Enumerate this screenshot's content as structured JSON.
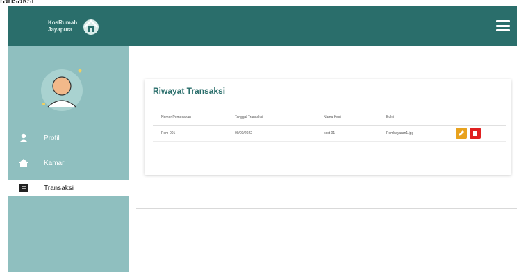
{
  "page": {
    "caption": "ransaksi"
  },
  "header": {
    "brand_line1": "KosRumah",
    "brand_line2": "Jayapura",
    "menu_icon": "hamburger-menu-icon"
  },
  "sidebar": {
    "items": [
      {
        "label": "Profil",
        "icon": "user-icon",
        "active": false
      },
      {
        "label": "Kamar",
        "icon": "home-icon",
        "active": false
      },
      {
        "label": "Transaksi",
        "icon": "receipt-icon",
        "active": true
      }
    ]
  },
  "main": {
    "card_title": "Riwayat Transaksi",
    "columns": [
      "Nomor Pemesanan",
      "Tanggal Transaksi",
      "Nama Kost",
      "Bukti"
    ],
    "rows": [
      {
        "nomor": "Pem-001",
        "tanggal": "00/00/2022",
        "nama": "kost 01",
        "bukti": "Pembayaran1.jpg"
      }
    ]
  },
  "colors": {
    "topbar": "#2a6e6b",
    "sidebar": "#8fbfbf",
    "title": "#2a6e6b",
    "edit": "#e8a21e",
    "delete": "#e02020"
  }
}
